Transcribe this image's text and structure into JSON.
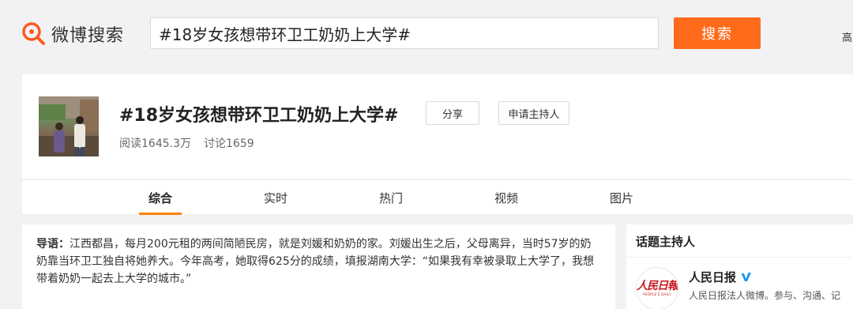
{
  "header": {
    "logo_text": "微博搜索",
    "logo_icon": "weibo-search-magnifier-icon",
    "search_value": "#18岁女孩想带环卫工奶奶上大学#",
    "search_button": "搜索",
    "advanced_link": "高"
  },
  "topic": {
    "title": "#18岁女孩想带环卫工奶奶上大学#",
    "share_label": "分享",
    "apply_host_label": "申请主持人",
    "reads": "阅读1645.3万",
    "discussions": "讨论1659"
  },
  "tabs": [
    {
      "label": "综合",
      "active": true
    },
    {
      "label": "实时",
      "active": false
    },
    {
      "label": "热门",
      "active": false
    },
    {
      "label": "视频",
      "active": false
    },
    {
      "label": "图片",
      "active": false
    }
  ],
  "guide": {
    "label": "导语：",
    "text": "江西都昌，每月200元租的两间简陋民房，就是刘媛和奶奶的家。刘媛出生之后，父母离异，当时57岁的奶奶靠当环卫工独自将她养大。今年高考，她取得625分的成绩，填报湖南大学：“如果我有幸被录取上大学了，我想带着奶奶一起去上大学的城市。”"
  },
  "sidebar": {
    "title": "话题主持人",
    "host_name": "人民日报",
    "host_avatar_text": "人民日報",
    "host_avatar_sub": "PEOPLE'S DAILY",
    "host_desc": "人民日报法人微博。参与、沟通、记",
    "verify_icon": "verified-v-icon"
  },
  "colors": {
    "accent": "#ff6b1a",
    "tab_underline": "#ff8200",
    "verify_blue": "#1b9ae8",
    "seal_red": "#c8161d"
  }
}
